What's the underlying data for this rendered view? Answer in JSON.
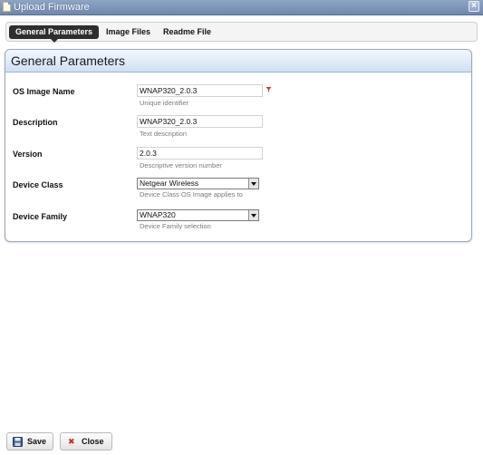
{
  "window": {
    "title": "Upload Firmware",
    "close_glyph": "×"
  },
  "tabs": [
    {
      "label": "General Parameters",
      "active": true
    },
    {
      "label": "Image Files",
      "active": false
    },
    {
      "label": "Readme File",
      "active": false
    }
  ],
  "panel": {
    "title": "General Parameters"
  },
  "fields": {
    "os_image_name": {
      "label": "OS Image Name",
      "value": "WNAP320_2.0.3",
      "hint": "Unique identifier",
      "required": true
    },
    "description": {
      "label": "Description",
      "value": "WNAP320_2.0.3",
      "hint": "Text description"
    },
    "version": {
      "label": "Version",
      "value": "2.0.3",
      "hint": "Descriptive version number"
    },
    "device_class": {
      "label": "Device Class",
      "value": "Netgear Wireless",
      "hint": "Device Class OS Image applies to"
    },
    "device_family": {
      "label": "Device Family",
      "value": "WNAP320",
      "hint": "Device Family selection"
    }
  },
  "buttons": {
    "save": {
      "label": "Save",
      "icon": "floppy-disk-icon"
    },
    "close": {
      "label": "Close",
      "icon": "red-x-icon",
      "glyph": "✖"
    }
  },
  "colors": {
    "titlebar": "#7a92b6",
    "active_tab": "#2e2e2e",
    "panel_header": "#cfe0f4",
    "close_icon": "#cc2a1f",
    "required_icon": "#d9342b"
  }
}
